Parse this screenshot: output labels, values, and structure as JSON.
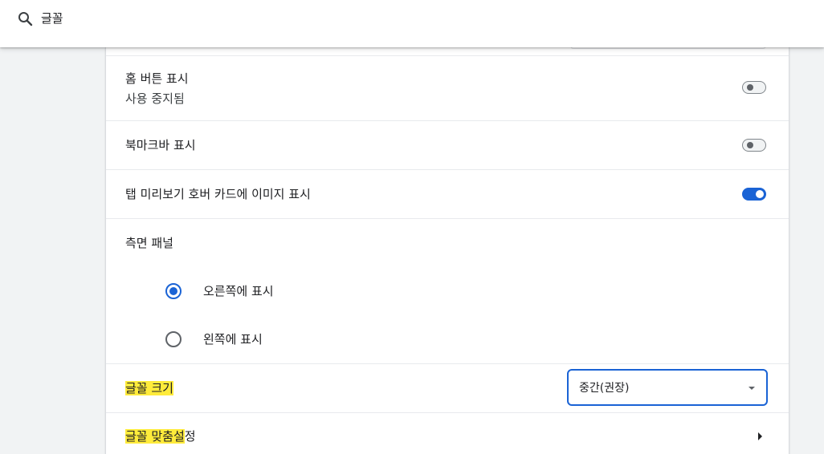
{
  "search": {
    "query": "글꼴"
  },
  "settings": {
    "home_button": {
      "label": "홈 버튼 표시",
      "sublabel": "사용 중지됨",
      "enabled": false
    },
    "bookmarks_bar": {
      "label": "북마크바 표시",
      "enabled": false
    },
    "tab_preview": {
      "label": "탭 미리보기 호버 카드에 이미지 표시",
      "enabled": true
    },
    "side_panel": {
      "label": "측면 패널",
      "options": [
        {
          "label": "오른쪽에 표시",
          "selected": true
        },
        {
          "label": "왼쪽에 표시",
          "selected": false
        }
      ]
    },
    "font_size": {
      "label_highlight": "글꼴 크기",
      "value": "중간(권장)"
    },
    "customize_fonts": {
      "label_highlight": "글꼴 맞춤설",
      "label_rest": "정"
    }
  },
  "colors": {
    "accent": "#1a63d5",
    "highlight": "#ffeb3b"
  },
  "icons": {
    "search": "search-icon",
    "dropdown": "arrow-drop-down-icon",
    "submenu": "chevron-right-icon"
  }
}
